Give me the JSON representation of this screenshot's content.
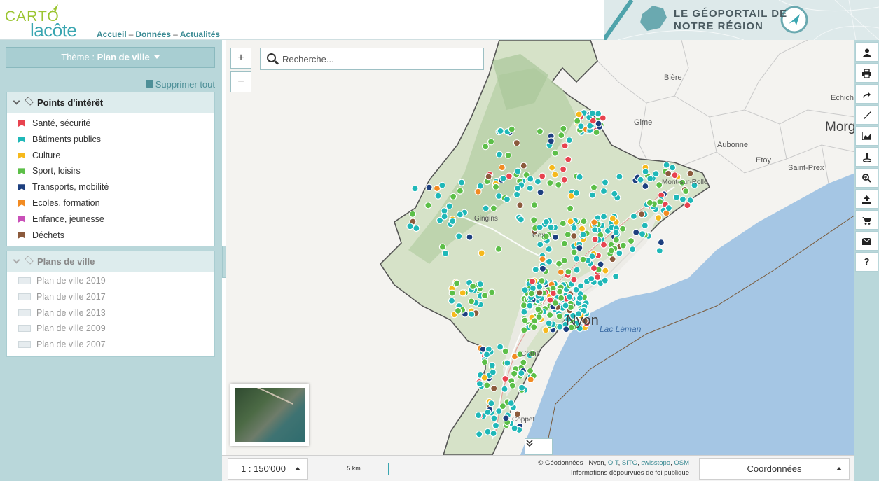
{
  "header": {
    "logo_top": "CARTO",
    "logo_bottom": "lacôte",
    "nav": [
      "Accueil",
      "Données",
      "Actualités"
    ],
    "banner_title_line1": "LE GÉOPORTAIL DE",
    "banner_title_line2": "NOTRE RÉGION"
  },
  "sidebar": {
    "theme_prefix": "Thème :",
    "theme_value": "Plan de ville",
    "clear_all": "Supprimer tout",
    "poi_group": {
      "title": "Points d'intérêt",
      "items": [
        {
          "label": "Santé, sécurité",
          "color": "#e8434f"
        },
        {
          "label": "Bâtiments publics",
          "color": "#1fb8b8"
        },
        {
          "label": "Culture",
          "color": "#f6b91c"
        },
        {
          "label": "Sport, loisirs",
          "color": "#5cbf48"
        },
        {
          "label": "Transports, mobilité",
          "color": "#1d3f7f"
        },
        {
          "label": "Ecoles, formation",
          "color": "#f28b22"
        },
        {
          "label": "Enfance, jeunesse",
          "color": "#c94fb8"
        },
        {
          "label": "Déchets",
          "color": "#8b5a3c"
        }
      ]
    },
    "plans_group": {
      "title": "Plans de ville",
      "items": [
        "Plan de ville 2019",
        "Plan de ville 2017",
        "Plan de ville 2013",
        "Plan de ville 2009",
        "Plan de ville 2007"
      ]
    }
  },
  "map": {
    "zoom_in": "+",
    "zoom_out": "−",
    "search_placeholder": "Recherche...",
    "labels": [
      "Bière",
      "Gimel",
      "Echich",
      "Morg",
      "Aubonne",
      "Etoy",
      "Saint-Prex",
      "Mont-sur-Rolle",
      "Gingins",
      "Gex",
      "Nyon",
      "Lac Léman",
      "Crans",
      "Coppet"
    ],
    "lake_color": "#a5c6e4",
    "region_color": "#c9dbb9"
  },
  "toolbar": {
    "tools": [
      "user-icon",
      "print-icon",
      "share-icon",
      "draw-icon",
      "profile-icon",
      "streetview-icon",
      "zoom-icon",
      "upload-icon",
      "cart-icon",
      "mail-icon",
      "help-icon"
    ]
  },
  "bottombar": {
    "scale": "1 : 150'000",
    "scalebar_label": "5 km",
    "credits_prefix": "© Géodonnées : Nyon,",
    "credits_links": [
      "OIT",
      "SITG",
      "swisstopo",
      "OSM"
    ],
    "credits_note": "Informations dépourvues de foi publique",
    "coordinates": "Coordonnées"
  }
}
